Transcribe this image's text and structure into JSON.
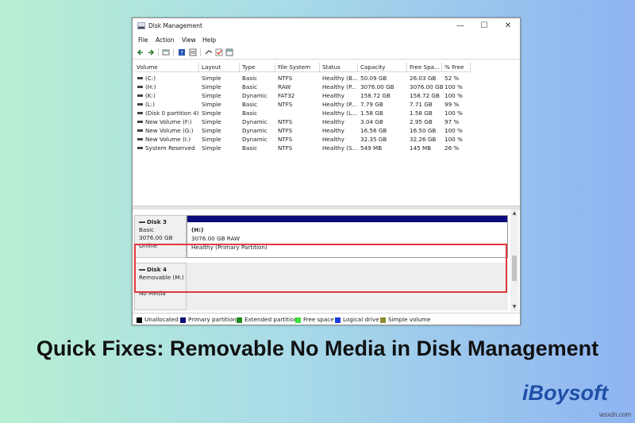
{
  "window": {
    "title": "Disk Management",
    "controls": {
      "minimize": "—",
      "maximize": "☐",
      "close": "✕"
    }
  },
  "menu": [
    "File",
    "Action",
    "View",
    "Help"
  ],
  "toolbar_icons": [
    "back-icon",
    "forward-icon",
    "properties-icon",
    "list-icon",
    "help-icon",
    "settings-icon",
    "connect-icon",
    "check-icon",
    "view-icon"
  ],
  "volume_table": {
    "columns": [
      "Volume",
      "Layout",
      "Type",
      "File System",
      "Status",
      "Capacity",
      "Free Spa...",
      "% Free"
    ],
    "rows": [
      [
        "(C:)",
        "Simple",
        "Basic",
        "NTFS",
        "Healthy (B...",
        "50.09 GB",
        "26.03 GB",
        "52 %"
      ],
      [
        "(H:)",
        "Simple",
        "Basic",
        "RAW",
        "Healthy (P...",
        "3076.00 GB",
        "3076.00 GB",
        "100 %"
      ],
      [
        "(K:)",
        "Simple",
        "Dynamic",
        "FAT32",
        "Healthy",
        "158.72 GB",
        "158.72 GB",
        "100 %"
      ],
      [
        "(L:)",
        "Simple",
        "Basic",
        "NTFS",
        "Healthy (P...",
        "7.79 GB",
        "7.71 GB",
        "99 %"
      ],
      [
        "(Disk 0 partition 4)",
        "Simple",
        "Basic",
        "",
        "Healthy (L...",
        "1.58 GB",
        "1.58 GB",
        "100 %"
      ],
      [
        "New Volume (F:)",
        "Simple",
        "Dynamic",
        "NTFS",
        "Healthy",
        "3.04 GB",
        "2.95 GB",
        "97 %"
      ],
      [
        "New Volume (G:)",
        "Simple",
        "Dynamic",
        "NTFS",
        "Healthy",
        "16.56 GB",
        "16.50 GB",
        "100 %"
      ],
      [
        "New Volume (I:)",
        "Simple",
        "Dynamic",
        "NTFS",
        "Healthy",
        "32.35 GB",
        "32.26 GB",
        "100 %"
      ],
      [
        "System Reserved",
        "Simple",
        "Basic",
        "NTFS",
        "Healthy (S...",
        "549 MB",
        "145 MB",
        "26 %"
      ]
    ]
  },
  "disks": {
    "disk3": {
      "name": "Disk 3",
      "type": "Basic",
      "size": "3076.00 GB",
      "state": "Online"
    },
    "disk3_partition": {
      "name": "(H:)",
      "detail": "3076.00 GB RAW",
      "status": "Healthy (Primary Partition)",
      "color": "#0c0c7c"
    },
    "disk4": {
      "name": "Disk 4",
      "type": "Removable (M:)",
      "state": "No Media"
    }
  },
  "legend": [
    {
      "label": "Unallocated",
      "color": "#000000"
    },
    {
      "label": "Primary partition",
      "color": "#0c0c7c"
    },
    {
      "label": "Extended partition",
      "color": "#1e8a1e"
    },
    {
      "label": "Free space",
      "color": "#3ae23a"
    },
    {
      "label": "Logical drive",
      "color": "#1d3be0"
    },
    {
      "label": "Simple volume",
      "color": "#8c8c2a"
    }
  ],
  "highlight_color": "#e0393e",
  "headline": "Quick Fixes: Removable No Media in Disk Management",
  "brand": "iBoysoft",
  "watermark": "wsxdn.com"
}
